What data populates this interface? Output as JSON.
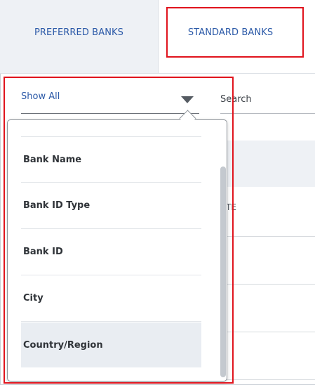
{
  "tabs": [
    {
      "label": "PREFERRED BANKS",
      "active": false
    },
    {
      "label": "STANDARD BANKS",
      "active": true
    }
  ],
  "filter": {
    "selected_label": "Show All",
    "search_placeholder": "Search",
    "search_value": "",
    "options": [
      {
        "label": ""
      },
      {
        "label": "Bank Name"
      },
      {
        "label": "Bank ID Type"
      },
      {
        "label": "Bank ID"
      },
      {
        "label": "City"
      },
      {
        "label": "Country/Region"
      }
    ],
    "highlighted_option": "Country/Region"
  },
  "table_fragment": {
    "header_partial": "TE"
  },
  "colors": {
    "accent_blue": "#2c5aa8",
    "highlight_red": "#e0141d",
    "tab_inactive_bg": "#eef1f5",
    "option_hover_bg": "#e9edf2"
  },
  "icons": {
    "filter_dropdown": "triangle-down"
  }
}
